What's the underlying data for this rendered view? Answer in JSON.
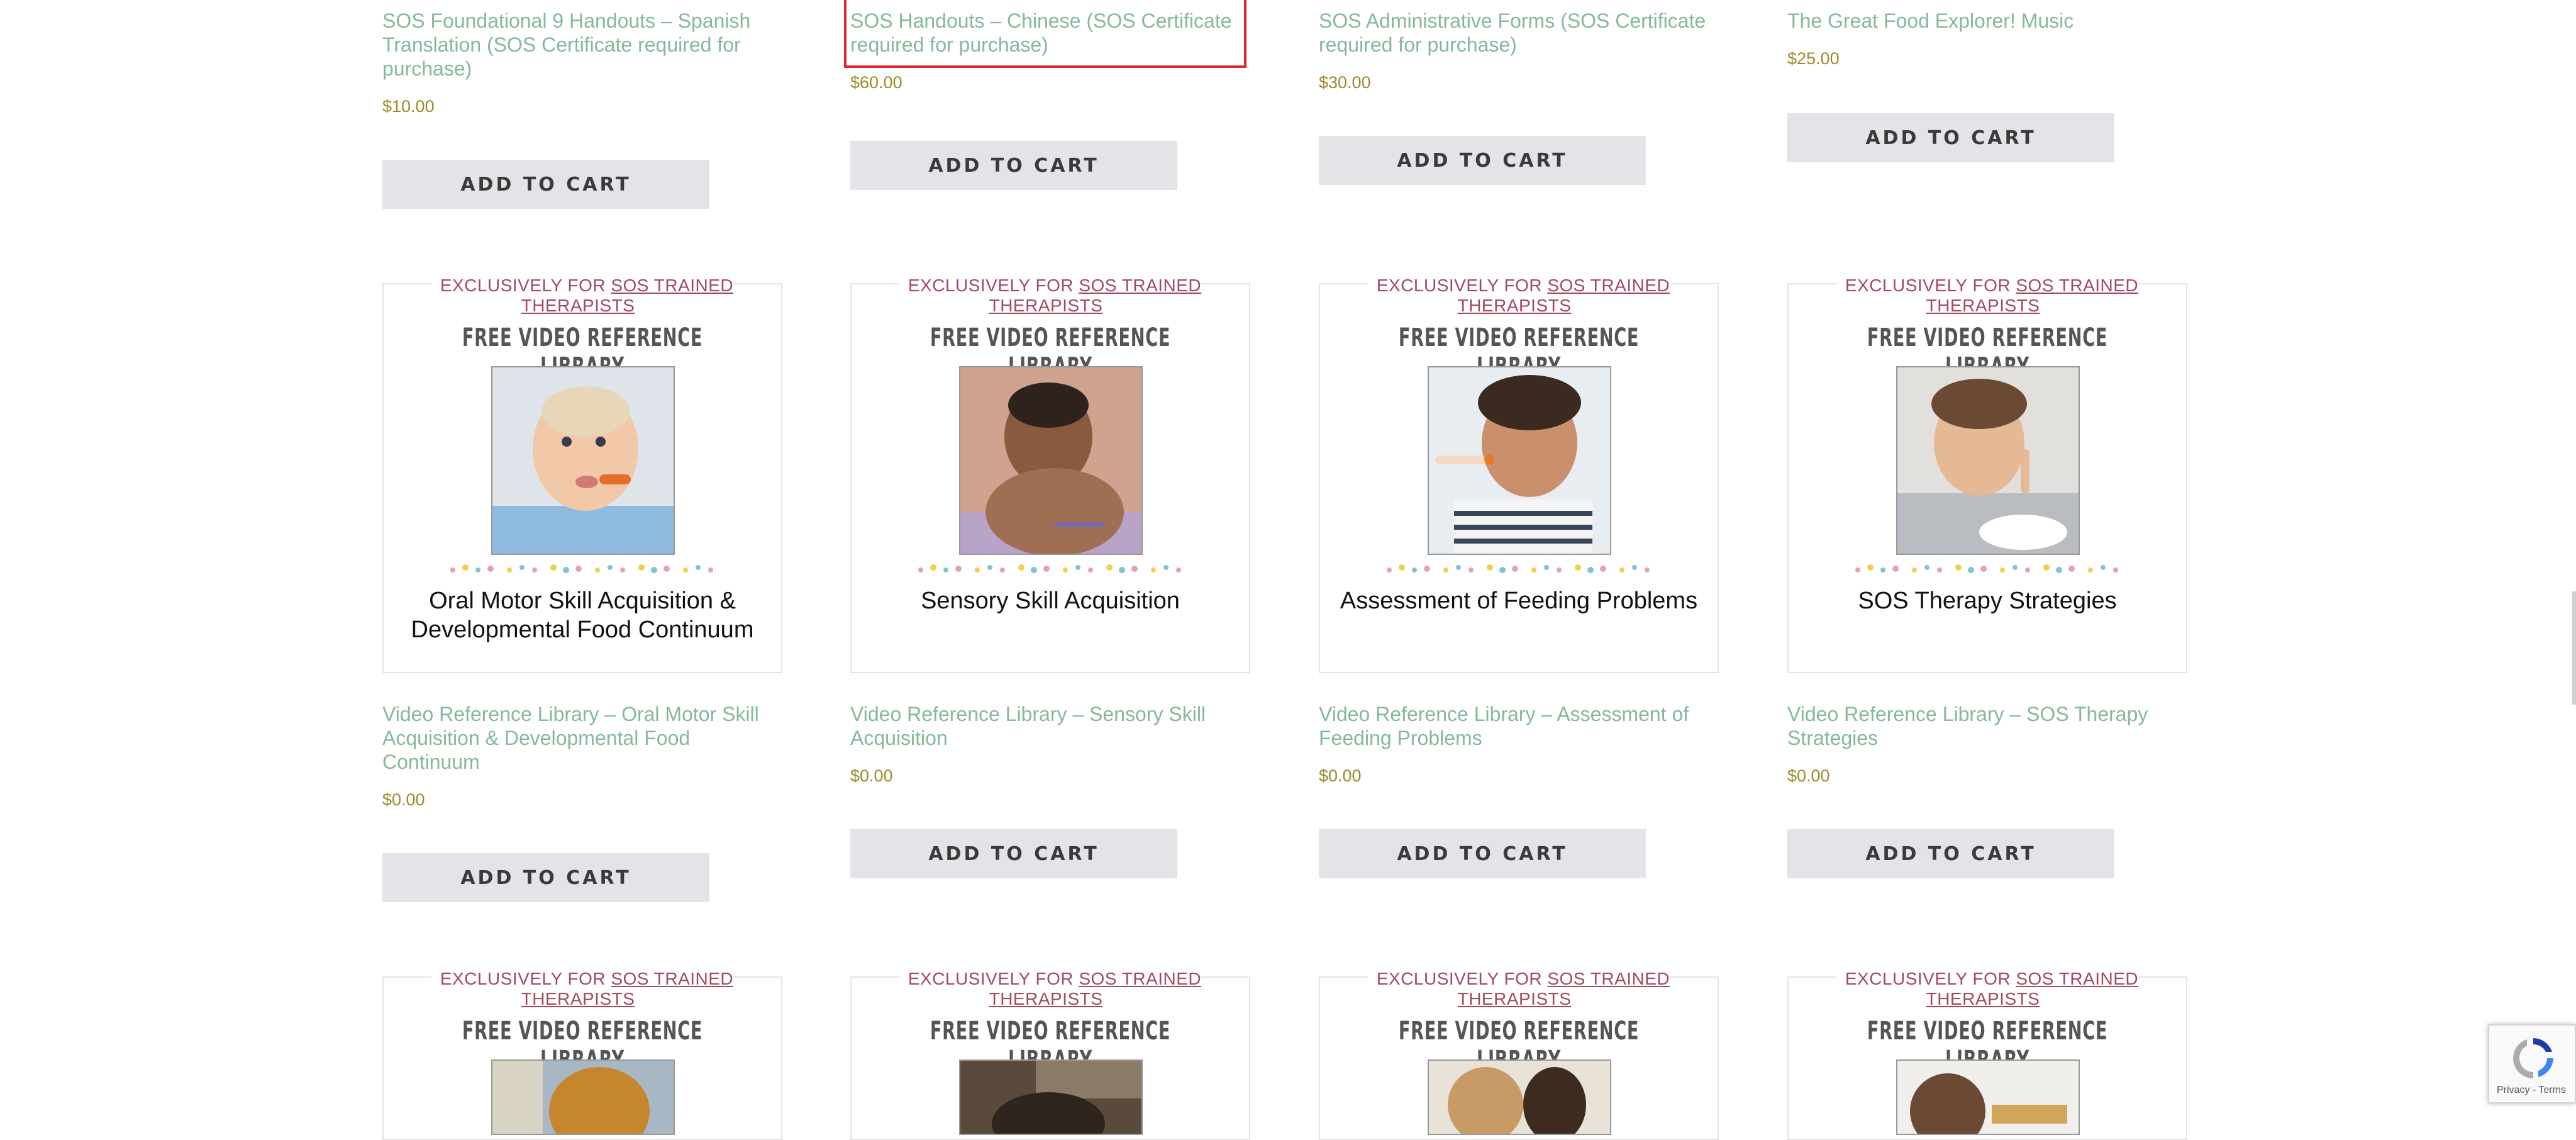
{
  "row1": [
    {
      "title": "SOS Foundational 9 Handouts – Spanish Translation (SOS Certificate required for purchase)",
      "price": "$10.00",
      "button": "ADD TO CART"
    },
    {
      "title": "SOS Handouts – Chinese (SOS Certificate required for purchase)",
      "price": "$60.00",
      "button": "ADD TO CART"
    },
    {
      "title": "SOS Administrative Forms (SOS Certificate required for purchase)",
      "price": "$30.00",
      "button": "ADD TO CART"
    },
    {
      "title": "The Great Food Explorer! Music",
      "price": "$25.00",
      "button": "ADD TO CART"
    }
  ],
  "card_common": {
    "exclusive_prefix": "EXCLUSIVELY FOR",
    "exclusive_link": "SOS TRAINED THERAPISTS",
    "heading": "FREE VIDEO REFERENCE LIBRARY"
  },
  "row2": [
    {
      "card_label": "Oral Motor Skill Acquisition & Developmental Food Continuum",
      "title": "Video Reference Library – Oral Motor Skill Acquisition & Developmental Food Continuum",
      "price": "$0.00",
      "button": "ADD TO CART"
    },
    {
      "card_label": "Sensory Skill Acquisition",
      "title": "Video Reference Library – Sensory Skill Acquisition",
      "price": "$0.00",
      "button": "ADD TO CART"
    },
    {
      "card_label": "Assessment of Feeding Problems",
      "title": "Video Reference Library – Assessment of Feeding Problems",
      "price": "$0.00",
      "button": "ADD TO CART"
    },
    {
      "card_label": "SOS Therapy Strategies",
      "title": "Video Reference Library – SOS Therapy Strategies",
      "price": "$0.00",
      "button": "ADD TO CART"
    }
  ],
  "recaptcha": {
    "terms": "Privacy - Terms"
  },
  "colors": {
    "title": "#86b89a",
    "price": "#9c8a2a",
    "accent": "#a24a5e",
    "button_bg": "#e3e3e8",
    "focus_outline": "#e0262b"
  }
}
